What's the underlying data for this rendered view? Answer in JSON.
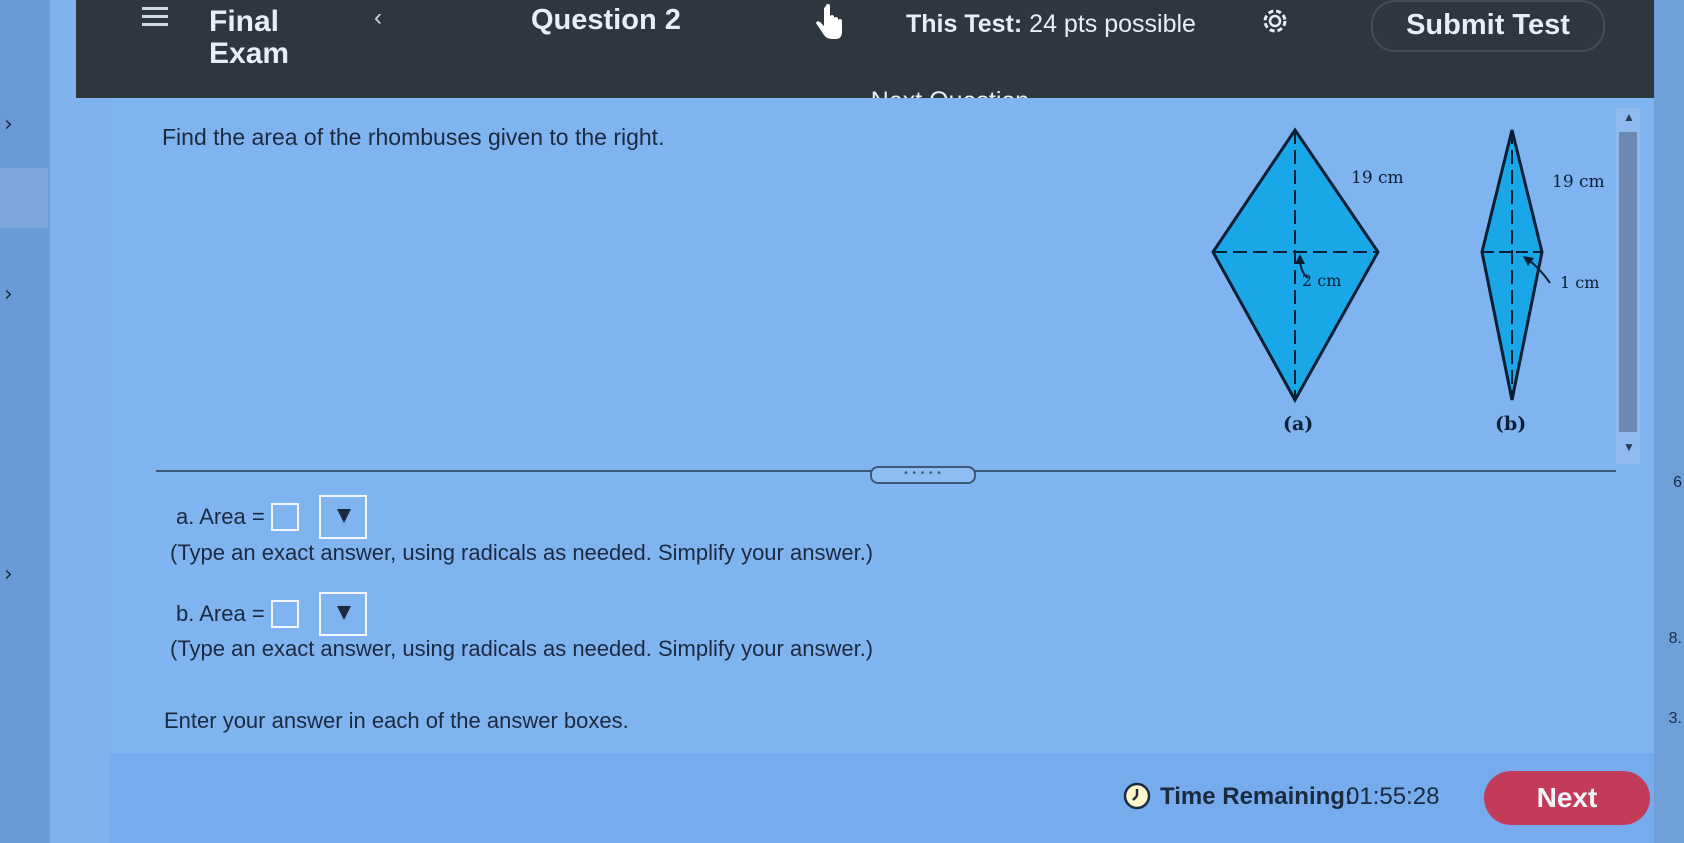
{
  "header": {
    "exam_title": "Final Exam",
    "question_title": "Question 2",
    "points_label": "This Test:",
    "points_value": "24 pts possible",
    "submit_label": "Submit Test"
  },
  "next_question_label": "Next Question",
  "question": {
    "prompt": "Find the area of the rhombuses given to the right.",
    "figure": {
      "a": {
        "side_label": "19 cm",
        "segment_label": "2 cm",
        "caption": "(a)"
      },
      "b": {
        "side_label": "19 cm",
        "segment_label": "1 cm",
        "caption": "(b)"
      }
    }
  },
  "answers": {
    "a_label": "a. Area =",
    "a_hint": "(Type an exact answer, using radicals as needed. Simplify your answer.)",
    "b_label": "b. Area =",
    "b_hint": "(Type an exact answer, using radicals as needed. Simplify your answer.)"
  },
  "status_message": "Enter your answer in each of the answer boxes.",
  "footer": {
    "time_label": "Time Remaining:",
    "time_value": "01:55:28",
    "next_label": "Next"
  },
  "right_edge_fragments": [
    "6",
    "8.",
    "3."
  ],
  "colors": {
    "header_bg": "#2e3640",
    "next_button": "#c23c5a",
    "rhombus_fill": "#1aa7e8"
  }
}
